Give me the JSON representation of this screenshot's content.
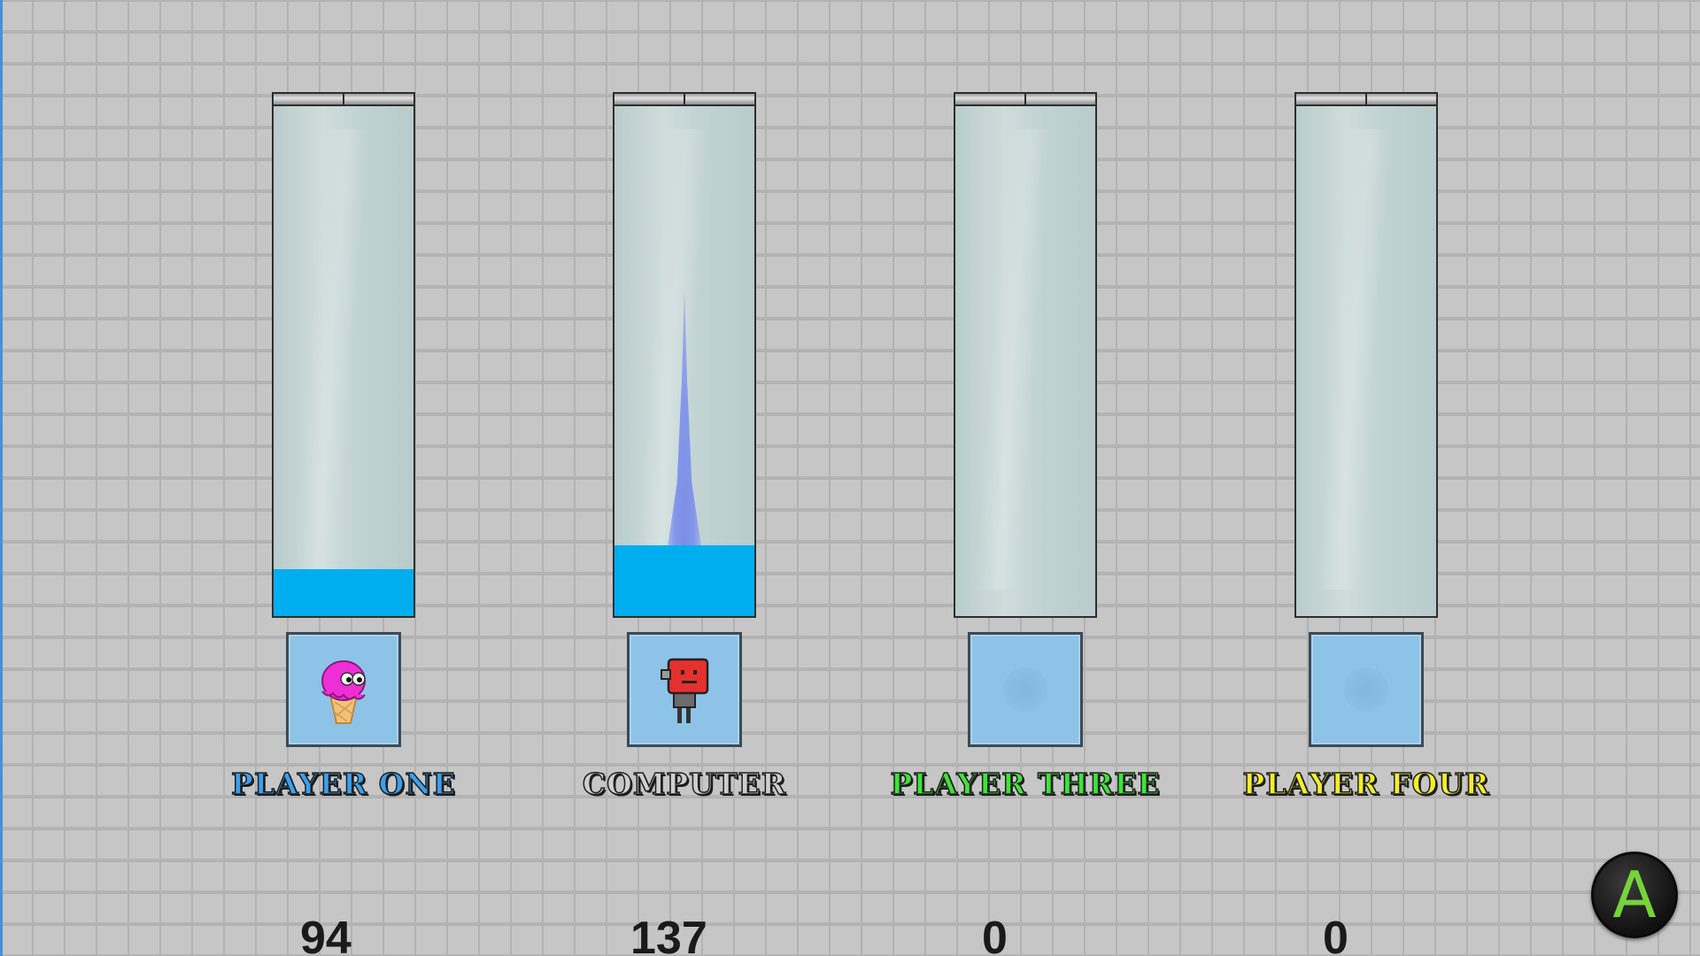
{
  "players": [
    {
      "name": "PLAYER ONE",
      "score": "94",
      "name_color": "#3aa0f0",
      "fill_color": "#00aeef",
      "fill_level": 0.09,
      "avatar": "ice-cream-character-icon",
      "has_stream": false
    },
    {
      "name": "COMPUTER",
      "score": "137",
      "name_color": "#cfcfcf",
      "fill_color": "#00aeef",
      "fill_level": 0.135,
      "avatar": "robot-character-icon",
      "has_stream": true
    },
    {
      "name": "PLAYER THREE",
      "score": "0",
      "name_color": "#3fe33a",
      "fill_color": "#00aeef",
      "fill_level": 0,
      "avatar": "empty-slot",
      "has_stream": false
    },
    {
      "name": "PLAYER FOUR",
      "score": "0",
      "name_color": "#f4ee2a",
      "fill_color": "#00aeef",
      "fill_level": 0,
      "avatar": "empty-slot",
      "has_stream": false
    }
  ],
  "action_button": {
    "label": "A",
    "icon": "a-button-icon",
    "color": "#74d43a"
  }
}
